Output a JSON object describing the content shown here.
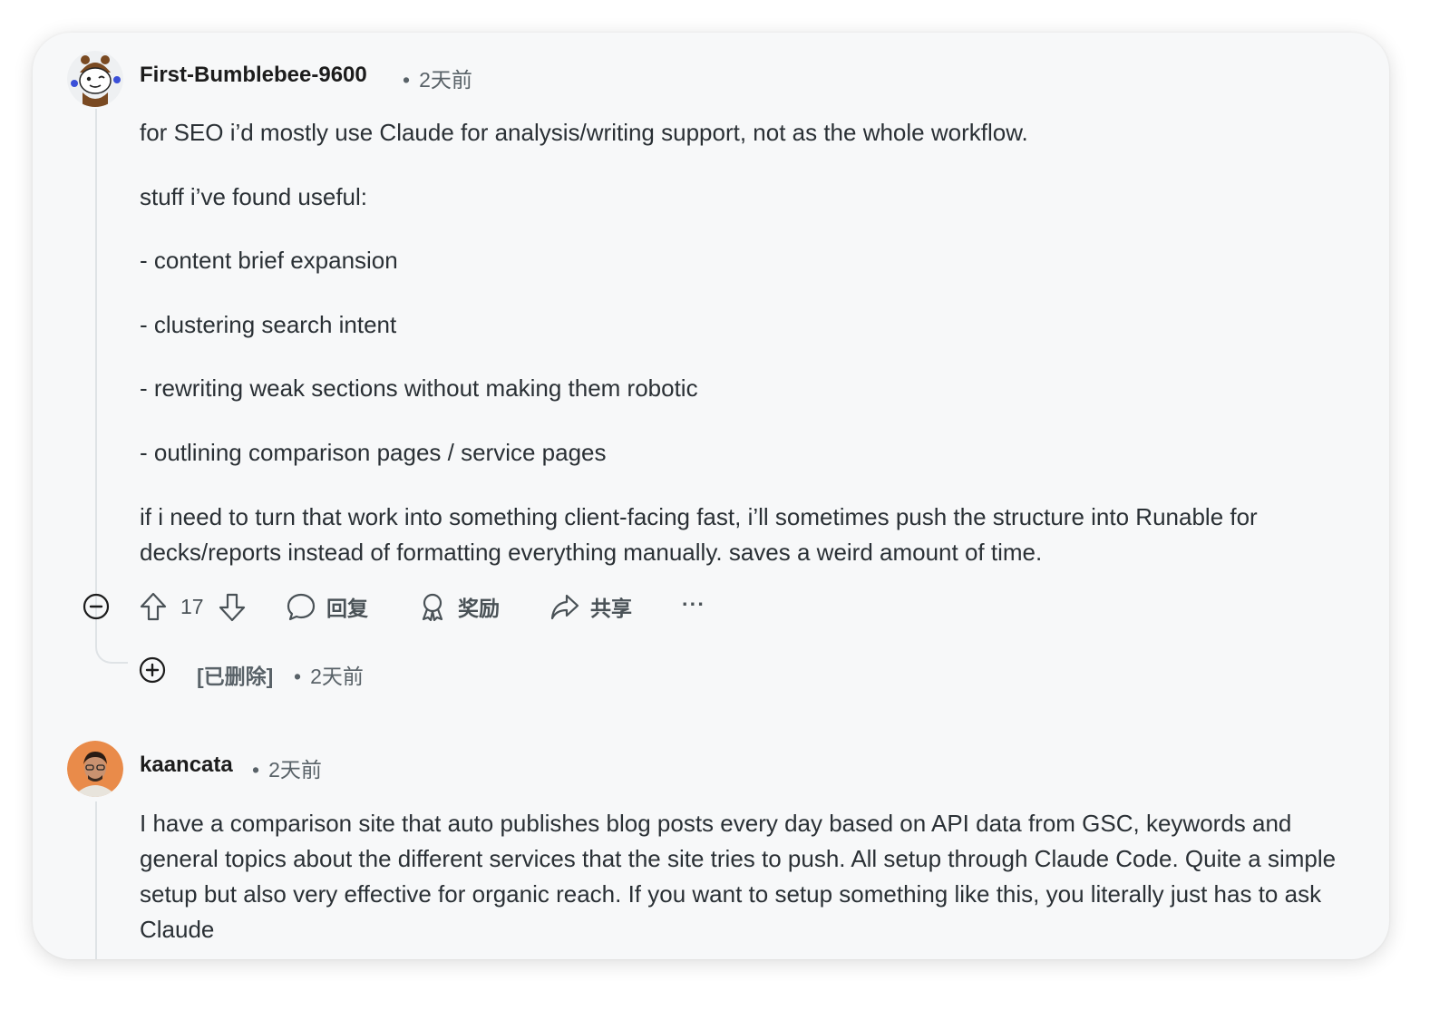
{
  "comments": [
    {
      "username": "First-Bumblebee-9600",
      "time": "2天前",
      "paragraphs": [
        "for SEO i’d mostly use Claude for analysis/writing support, not as the whole workflow.",
        "stuff i’ve found useful:",
        "- content brief expansion",
        "- clustering search intent",
        "- rewriting weak sections without making them robotic",
        "- outlining comparison pages / service pages",
        "if i need to turn that work into something client-facing fast, i’ll sometimes push the structure into Runable for decks/reports instead of formatting everything manually. saves a weird amount of time."
      ],
      "actions": {
        "vote_count": "17",
        "reply_label": "回复",
        "award_label": "奖励",
        "share_label": "共享",
        "more_label": "···"
      }
    },
    {
      "username": "kaancata",
      "time": "2天前",
      "paragraphs": [
        "I have a comparison site that auto publishes blog posts every day based on API data from GSC, keywords and general topics about the different services that the site tries to push. All setup through Claude Code. Quite a simple setup but also very effective for organic reach. If you want to setup something like this, you literally just has to ask Claude"
      ]
    }
  ],
  "deleted_reply": {
    "label": "[已删除]",
    "time": "2天前"
  },
  "separator": "•",
  "icons": {
    "collapse": "minus-circle-icon",
    "expand": "plus-circle-icon",
    "upvote": "arrow-up-icon",
    "downvote": "arrow-down-icon",
    "reply": "speech-bubble-icon",
    "award": "award-ribbon-icon",
    "share": "share-arrow-icon"
  },
  "colors": {
    "card_background": "#f7f8f9",
    "text": "#2a3035",
    "meta": "#596268",
    "thread_line": "#dfe3e6"
  }
}
